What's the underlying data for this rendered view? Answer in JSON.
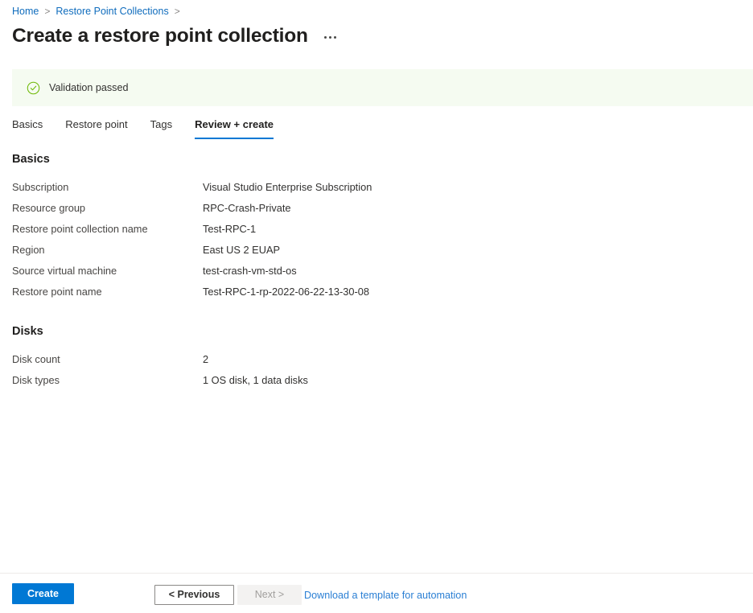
{
  "breadcrumb": {
    "items": [
      {
        "label": "Home"
      },
      {
        "label": "Restore Point Collections"
      }
    ],
    "separator": ">"
  },
  "header": {
    "title": "Create a restore point collection",
    "more_menu": "..."
  },
  "banner": {
    "icon": "check-circle-icon",
    "text": "Validation passed",
    "background": "#f5fbf1",
    "icon_color": "#6bb700"
  },
  "tabs": [
    {
      "label": "Basics",
      "active": false
    },
    {
      "label": "Restore point",
      "active": false
    },
    {
      "label": "Tags",
      "active": false
    },
    {
      "label": "Review + create",
      "active": true
    }
  ],
  "sections": [
    {
      "heading": "Basics",
      "rows": [
        {
          "key": "Subscription",
          "value": "Visual Studio Enterprise Subscription"
        },
        {
          "key": "Resource group",
          "value": "RPC-Crash-Private"
        },
        {
          "key": "Restore point collection name",
          "value": "Test-RPC-1"
        },
        {
          "key": "Region",
          "value": "East US 2 EUAP"
        },
        {
          "key": "Source virtual machine",
          "value": "test-crash-vm-std-os"
        },
        {
          "key": "Restore point name",
          "value": "Test-RPC-1-rp-2022-06-22-13-30-08"
        }
      ]
    },
    {
      "heading": "Disks",
      "rows": [
        {
          "key": "Disk count",
          "value": "2"
        },
        {
          "key": "Disk types",
          "value": "1 OS disk, 1 data disks"
        }
      ]
    }
  ],
  "footer": {
    "create_label": "Create",
    "previous_label": "< Previous",
    "next_label": "Next >",
    "template_link": "Download a template for automation",
    "accent_color": "#0078d4"
  }
}
